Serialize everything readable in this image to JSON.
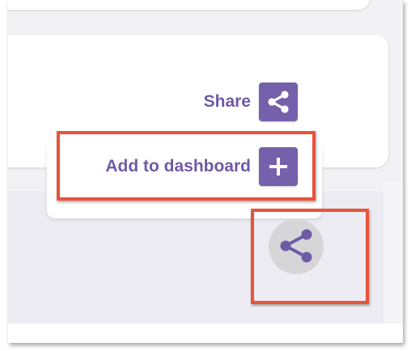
{
  "menu": {
    "share_label": "Share",
    "share_icon": "share-icon",
    "add_label": "Add to dashboard",
    "add_icon": "plus-icon"
  },
  "fab": {
    "icon": "share-icon"
  },
  "colors": {
    "accent": "#7560ab",
    "label_text": "#6e5ba6",
    "annotation": "#e8533a",
    "fab_background": "#d6d6d9"
  }
}
